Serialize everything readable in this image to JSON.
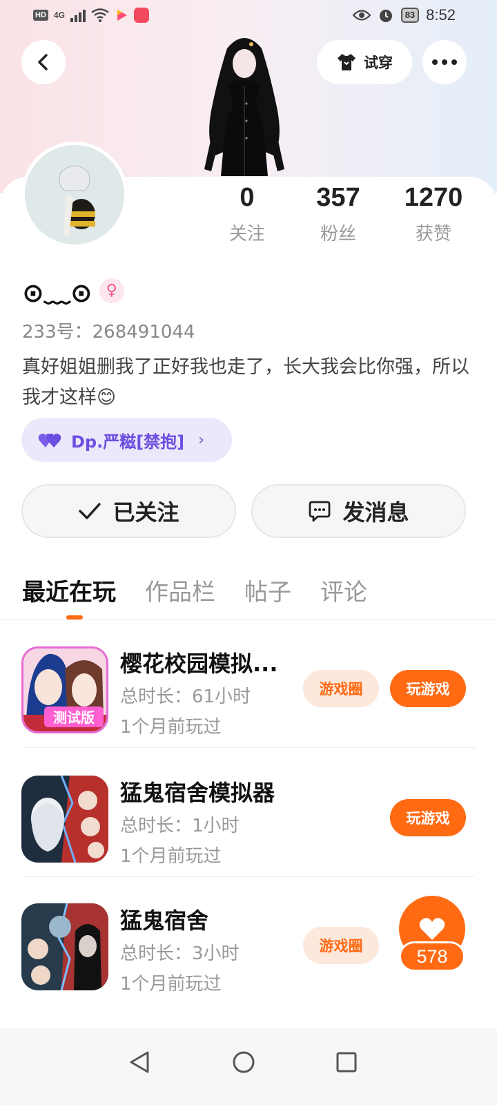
{
  "status_bar": {
    "network": "HD",
    "signal_label": "4G",
    "battery": "83",
    "time": "8:52",
    "icons": [
      "hd-icon",
      "signal-icon",
      "wifi-icon",
      "video-app-icon",
      "app-icon",
      "eye-icon",
      "alarm-icon",
      "battery-icon"
    ]
  },
  "header": {
    "tryon_label": "试穿",
    "icons": [
      "back-icon",
      "tshirt-icon",
      "more-icon"
    ]
  },
  "profile": {
    "nickname": "⊙﹏⊙",
    "gender_symbol": "♀",
    "uid": "233号：268491044",
    "bio": "真好姐姐删我了正好我也走了，长大我会比你强，所以我才这样😊",
    "guild": "Dp.严糍[禁抱]",
    "stats": [
      {
        "value": "0",
        "label": "关注"
      },
      {
        "value": "357",
        "label": "粉丝"
      },
      {
        "value": "1270",
        "label": "获赞"
      }
    ]
  },
  "actions": {
    "follow_label": "已关注",
    "message_label": "发消息"
  },
  "tabs": [
    {
      "label": "最近在玩",
      "active": true
    },
    {
      "label": "作品栏",
      "active": false
    },
    {
      "label": "帖子",
      "active": false
    },
    {
      "label": "评论",
      "active": false
    }
  ],
  "games": [
    {
      "title": "樱花校园模拟...",
      "duration": "总时长：61小时",
      "last_played": "1个月前玩过",
      "circle_label": "游戏圈",
      "play_label": "玩游戏",
      "icon_text": "测试版"
    },
    {
      "title": "猛鬼宿舍模拟器",
      "duration": "总时长：1小时",
      "last_played": "1个月前玩过",
      "circle_label": "",
      "play_label": "玩游戏"
    },
    {
      "title": "猛鬼宿舍",
      "duration": "总时长：3小时",
      "last_played": "1个月前玩过",
      "circle_label": "游戏圈",
      "play_label": ""
    }
  ],
  "like_fab": {
    "count": "578"
  },
  "colors": {
    "accent": "#ff6a13",
    "guild_purple": "#6c4ee0",
    "gender_pink": "#f2578a"
  }
}
